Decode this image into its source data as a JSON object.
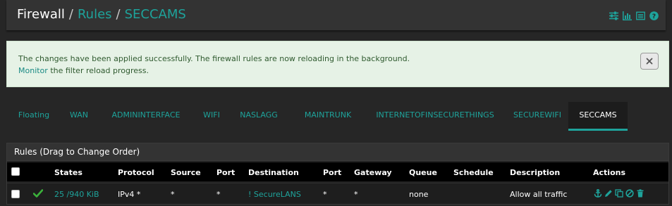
{
  "breadcrumb": {
    "root": "Firewall",
    "sep1": "/",
    "rules": "Rules",
    "sep2": "/",
    "current": "SECCAMS"
  },
  "header_icons": [
    "sliders-icon",
    "bar-chart-icon",
    "list-icon",
    "help-icon"
  ],
  "alert": {
    "message": "The changes have been applied successfully. The firewall rules are now reloading in the background.",
    "link_text": "Monitor",
    "suffix": " the filter reload progress.",
    "close_icon": "close-icon"
  },
  "tabs": [
    "Floating",
    "WAN",
    "ADMININTERFACE",
    "WIFI",
    "NASLAGG",
    "MAINTRUNK",
    "INTERNETOFINSECURETHINGS",
    "SECUREWIFI",
    "SECCAMS"
  ],
  "active_tab": "SECCAMS",
  "panel": {
    "title": "Rules (Drag to Change Order)"
  },
  "columns": {
    "states": "States",
    "protocol": "Protocol",
    "source": "Source",
    "port": "Port",
    "destination": "Destination",
    "port2": "Port",
    "gateway": "Gateway",
    "queue": "Queue",
    "schedule": "Schedule",
    "description": "Description",
    "actions": "Actions"
  },
  "row": {
    "states": "25 /940 KiB",
    "protocol": "IPv4 *",
    "source": "*",
    "port": "*",
    "destination": "! SecureLANS",
    "port2": "*",
    "gateway": "*",
    "queue": "none",
    "schedule": "",
    "description": "Allow all traffic",
    "status_icon": "check-icon",
    "action_icons": [
      "anchor-icon",
      "pencil-icon",
      "copy-icon",
      "disable-icon",
      "trash-icon"
    ]
  },
  "colors": {
    "accent": "#1ea39b",
    "success_bg": "#e6f2e6",
    "enabled_check": "#3bb33b"
  }
}
